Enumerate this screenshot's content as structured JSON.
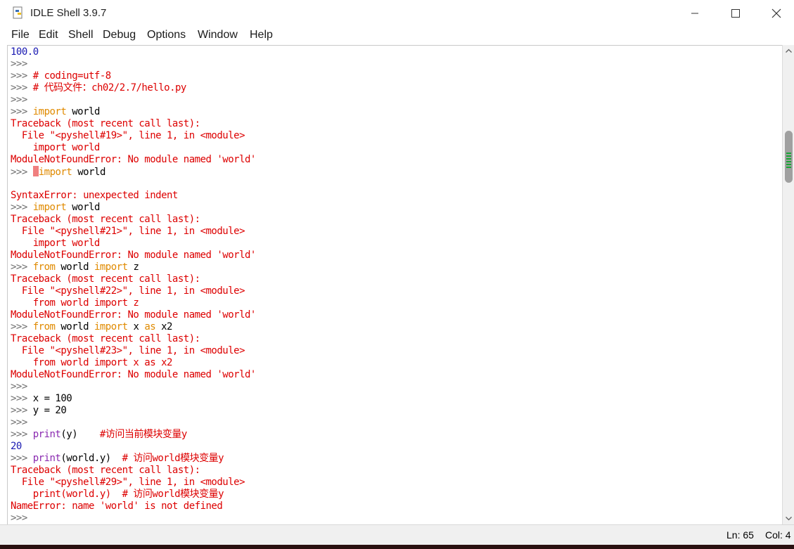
{
  "window": {
    "title": "IDLE Shell 3.9.7",
    "controls": [
      "minimize",
      "maximize",
      "close"
    ]
  },
  "menu": [
    "File",
    "Edit",
    "Shell",
    "Debug",
    "Options",
    "Window",
    "Help"
  ],
  "colors": {
    "output": "#1a1ab2",
    "prompt": "#6e6e6e",
    "keyword": "#e08a00",
    "builtin": "#8a2ab0",
    "comment": "#dd0000",
    "error": "#dd0000",
    "text": "#000000",
    "cursor": "#f07f7f"
  },
  "shell": {
    "lines": [
      [
        [
          "100.0",
          "output"
        ]
      ],
      [
        [
          ">>>",
          "prompt"
        ]
      ],
      [
        [
          ">>> ",
          "prompt"
        ],
        [
          "# coding=utf-8",
          "comment"
        ]
      ],
      [
        [
          ">>> ",
          "prompt"
        ],
        [
          "# 代码文件：ch02/2.7/hello.py",
          "comment"
        ]
      ],
      [
        [
          ">>>",
          "prompt"
        ]
      ],
      [
        [
          ">>> ",
          "prompt"
        ],
        [
          "import",
          "keyword"
        ],
        [
          " world",
          "text"
        ]
      ],
      [
        [
          "Traceback (most recent call last):",
          "error"
        ]
      ],
      [
        [
          "  File \"<pyshell#19>\", line 1, in <module>",
          "error"
        ]
      ],
      [
        [
          "    import world",
          "error"
        ]
      ],
      [
        [
          "ModuleNotFoundError: No module named 'world'",
          "error"
        ]
      ],
      [
        [
          ">>> ",
          "prompt"
        ],
        [
          "",
          "cursor"
        ],
        [
          "import",
          "keyword"
        ],
        [
          " world",
          "text"
        ]
      ],
      [],
      [
        [
          "SyntaxError: unexpected indent",
          "error"
        ]
      ],
      [
        [
          ">>> ",
          "prompt"
        ],
        [
          "import",
          "keyword"
        ],
        [
          " world",
          "text"
        ]
      ],
      [
        [
          "Traceback (most recent call last):",
          "error"
        ]
      ],
      [
        [
          "  File \"<pyshell#21>\", line 1, in <module>",
          "error"
        ]
      ],
      [
        [
          "    import world",
          "error"
        ]
      ],
      [
        [
          "ModuleNotFoundError: No module named 'world'",
          "error"
        ]
      ],
      [
        [
          ">>> ",
          "prompt"
        ],
        [
          "from",
          "keyword"
        ],
        [
          " world ",
          "text"
        ],
        [
          "import",
          "keyword"
        ],
        [
          " z",
          "text"
        ]
      ],
      [
        [
          "Traceback (most recent call last):",
          "error"
        ]
      ],
      [
        [
          "  File \"<pyshell#22>\", line 1, in <module>",
          "error"
        ]
      ],
      [
        [
          "    from world import z",
          "error"
        ]
      ],
      [
        [
          "ModuleNotFoundError: No module named 'world'",
          "error"
        ]
      ],
      [
        [
          ">>> ",
          "prompt"
        ],
        [
          "from",
          "keyword"
        ],
        [
          " world ",
          "text"
        ],
        [
          "import",
          "keyword"
        ],
        [
          " x ",
          "text"
        ],
        [
          "as",
          "keyword"
        ],
        [
          " x2",
          "text"
        ]
      ],
      [
        [
          "Traceback (most recent call last):",
          "error"
        ]
      ],
      [
        [
          "  File \"<pyshell#23>\", line 1, in <module>",
          "error"
        ]
      ],
      [
        [
          "    from world import x as x2",
          "error"
        ]
      ],
      [
        [
          "ModuleNotFoundError: No module named 'world'",
          "error"
        ]
      ],
      [
        [
          ">>>",
          "prompt"
        ]
      ],
      [
        [
          ">>> ",
          "prompt"
        ],
        [
          "x = 100",
          "text"
        ]
      ],
      [
        [
          ">>> ",
          "prompt"
        ],
        [
          "y = 20",
          "text"
        ]
      ],
      [
        [
          ">>>",
          "prompt"
        ]
      ],
      [
        [
          ">>> ",
          "prompt"
        ],
        [
          "print",
          "builtin"
        ],
        [
          "(y)    ",
          "text"
        ],
        [
          "#访问当前模块变量y",
          "comment"
        ]
      ],
      [
        [
          "20",
          "output"
        ]
      ],
      [
        [
          ">>> ",
          "prompt"
        ],
        [
          "print",
          "builtin"
        ],
        [
          "(world.y)  ",
          "text"
        ],
        [
          "# 访问world模块变量y",
          "comment"
        ]
      ],
      [
        [
          "Traceback (most recent call last):",
          "error"
        ]
      ],
      [
        [
          "  File \"<pyshell#29>\", line 1, in <module>",
          "error"
        ]
      ],
      [
        [
          "    print(world.y)  # 访问world模块变量y",
          "error"
        ]
      ],
      [
        [
          "NameError: name 'world' is not defined",
          "error"
        ]
      ],
      [
        [
          ">>>",
          "prompt"
        ]
      ]
    ]
  },
  "status": {
    "line": "Ln: 65",
    "col": "Col: 4"
  }
}
